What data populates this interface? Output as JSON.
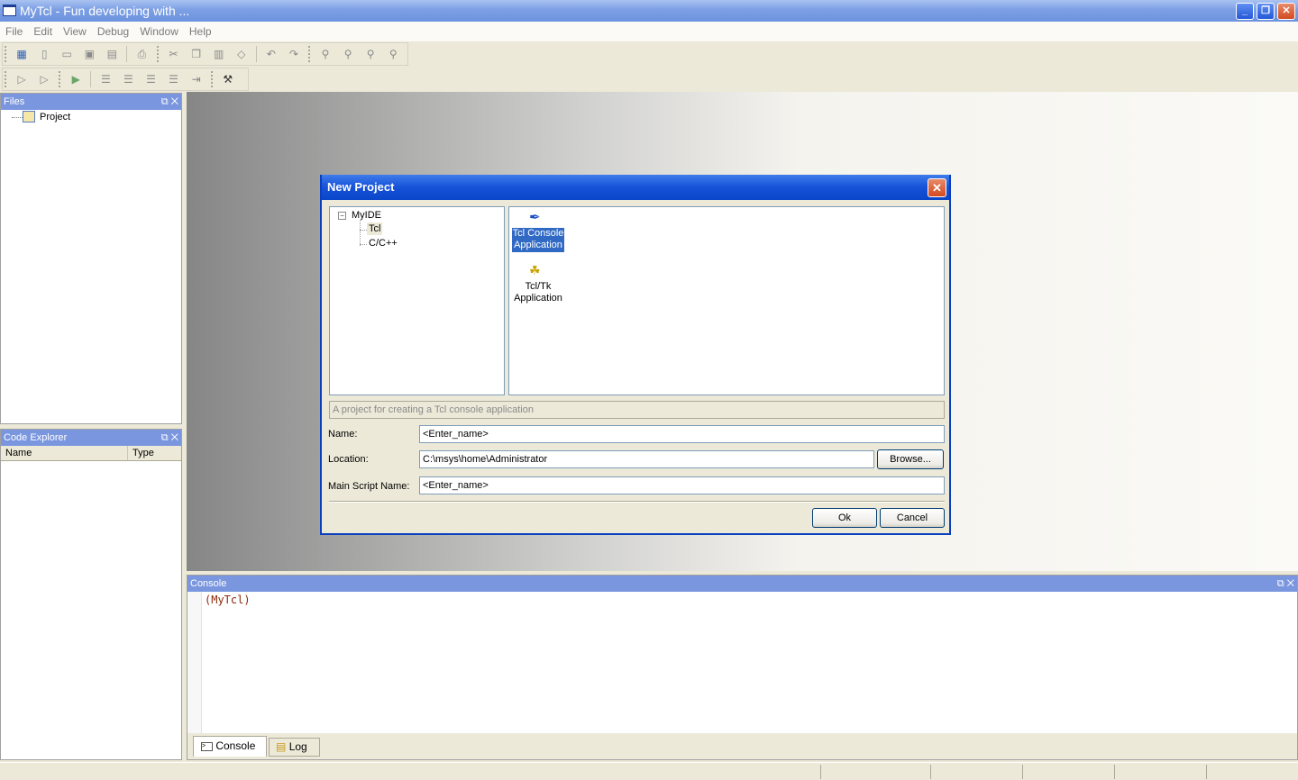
{
  "window": {
    "title": "MyTcl - Fun developing with ..."
  },
  "menu": [
    "File",
    "Edit",
    "View",
    "Debug",
    "Window",
    "Help"
  ],
  "toolbar1": [
    "project-icon",
    "new-file-icon",
    "open-icon",
    "save-icon",
    "save-all-icon",
    "print-icon",
    "cut-icon",
    "copy-icon",
    "paste-icon",
    "delete-icon",
    "undo-icon",
    "redo-icon",
    "find-icon",
    "find-next-icon",
    "replace-icon",
    "find-in-files-icon"
  ],
  "toolbar2": [
    "debug-run-icon",
    "debug-stop-icon",
    "run-icon",
    "indent-icon",
    "outdent-icon",
    "comment-icon",
    "uncomment-icon",
    "tab-icon",
    "tools-icon"
  ],
  "files_panel": {
    "title": "Files",
    "tree_root": "Project"
  },
  "code_explorer": {
    "title": "Code Explorer",
    "col_name": "Name",
    "col_type": "Type"
  },
  "dialog": {
    "title": "New Project",
    "tree": {
      "root": "MyIDE",
      "children": [
        "Tcl",
        "C/C++"
      ]
    },
    "templates": [
      {
        "line1": "Tcl Console",
        "line2": "Application",
        "selected": true
      },
      {
        "line1": "Tcl/Tk",
        "line2": "Application",
        "selected": false
      }
    ],
    "description": "A project for creating a Tcl console application",
    "name_label": "Name:",
    "name_value": "<Enter_name>",
    "location_label": "Location:",
    "location_value": "C:\\msys\\home\\Administrator",
    "browse_label": "Browse...",
    "script_label": "Main Script Name:",
    "script_value": "<Enter_name>",
    "ok_label": "Ok",
    "cancel_label": "Cancel"
  },
  "console": {
    "title": "Console",
    "prompt": "(MyTcl)",
    "tab_console": "Console",
    "tab_log": "Log"
  },
  "colors": {
    "title_blue": "#0a46c8",
    "panel_header": "#7a96df",
    "prompt_color": "#8b2a0a"
  }
}
